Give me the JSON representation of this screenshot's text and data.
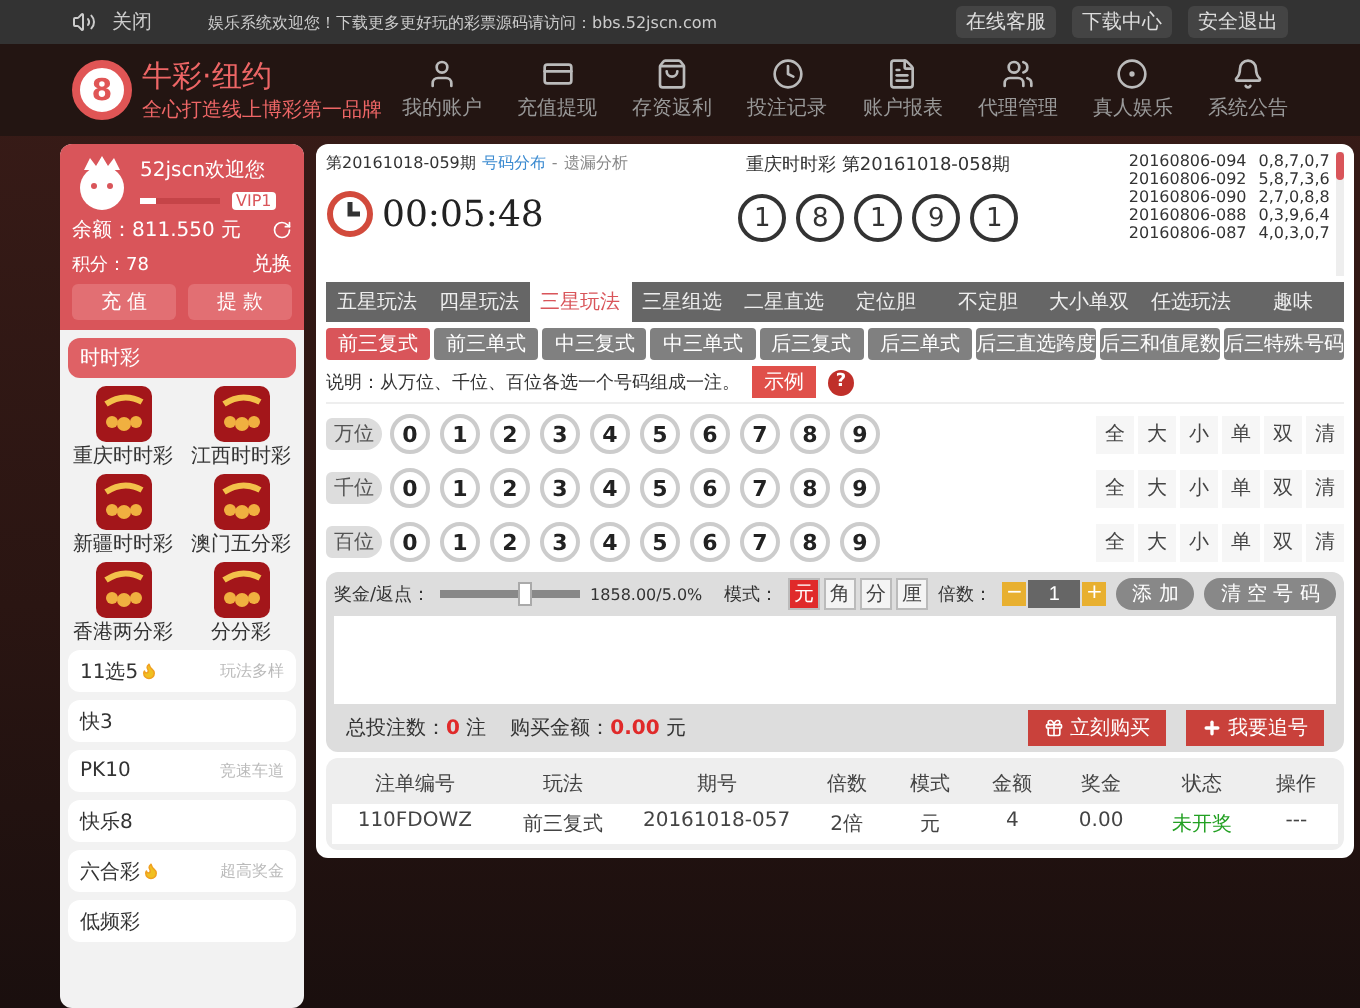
{
  "top_bar": {
    "sound_label": "关闭",
    "notice": "娱乐系统欢迎您！下载更多更好玩的彩票源码请访问：bbs.52jscn.com",
    "links": [
      "在线客服",
      "下载中心",
      "安全退出"
    ]
  },
  "logo": {
    "badge": "8",
    "title": "牛彩·纽约",
    "slogan": "全心打造线上博彩第一品牌"
  },
  "nav": [
    "我的账户",
    "充值提现",
    "存资返利",
    "投注记录",
    "账户报表",
    "代理管理",
    "真人娱乐",
    "系统公告"
  ],
  "sidebar": {
    "user": {
      "name": "52jscn欢迎您",
      "vip": "VIP1",
      "level": 0.2,
      "balance": "余额：811.550 元",
      "points": "积分：78",
      "exchange": "兑换",
      "buttons": [
        "充 值",
        "提 款"
      ]
    },
    "section": "时时彩",
    "games": [
      "重庆时时彩",
      "江西时时彩",
      "新疆时时彩",
      "澳门五分彩",
      "香港两分彩",
      "分分彩"
    ],
    "categories": [
      {
        "label": "11选5",
        "hot": true,
        "note": "玩法多样"
      },
      {
        "label": "快3",
        "hot": false
      },
      {
        "label": "PK10",
        "hot": false,
        "note": "竞速车道"
      },
      {
        "label": "快乐8",
        "hot": false
      },
      {
        "label": "六合彩",
        "hot": true,
        "note": "超高奖金"
      },
      {
        "label": "低频彩",
        "hot": false
      }
    ]
  },
  "draw": {
    "period": "第20161018-059期",
    "links": [
      "号码分布",
      "遗漏分析"
    ],
    "link_separator": "-",
    "countdown": "00:05:48",
    "last_title": "重庆时时彩 第20161018-058期",
    "balls": [
      "1",
      "8",
      "1",
      "9",
      "1"
    ],
    "history": [
      {
        "issue": "20160806-094",
        "numbers": "0,8,7,0,7"
      },
      {
        "issue": "20160806-092",
        "numbers": "5,8,7,3,6"
      },
      {
        "issue": "20160806-090",
        "numbers": "2,7,0,8,8"
      },
      {
        "issue": "20160806-088",
        "numbers": "0,3,9,6,4"
      },
      {
        "issue": "20160806-087",
        "numbers": "4,0,3,0,7"
      }
    ]
  },
  "tabs": [
    {
      "label": "五星玩法",
      "selected": false
    },
    {
      "label": "四星玩法",
      "selected": false
    },
    {
      "label": "三星玩法",
      "selected": true
    },
    {
      "label": "三星组选",
      "selected": false
    },
    {
      "label": "二星直选",
      "selected": false
    },
    {
      "label": "定位胆",
      "selected": false
    },
    {
      "label": "不定胆",
      "selected": false
    },
    {
      "label": "大小单双",
      "selected": false
    },
    {
      "label": "任选玩法",
      "selected": false
    },
    {
      "label": "趣味",
      "selected": false
    }
  ],
  "subtabs": [
    {
      "label": "前三复式",
      "selected": true
    },
    {
      "label": "前三单式",
      "selected": false
    },
    {
      "label": "中三复式",
      "selected": false
    },
    {
      "label": "中三单式",
      "selected": false
    },
    {
      "label": "后三复式",
      "selected": false
    },
    {
      "label": "后三单式",
      "selected": false
    },
    {
      "label": "后三直选跨度",
      "selected": false
    },
    {
      "label": "后三和值尾数",
      "selected": false
    },
    {
      "label": "后三特殊号码",
      "selected": false
    }
  ],
  "description": "说明：从万位、千位、百位各选一个号码组成一注。",
  "example_button": "示例",
  "help": "?",
  "rows": [
    {
      "label": "万位",
      "digits": [
        {
          "n": "0",
          "selected": false
        },
        {
          "n": "1",
          "selected": false
        },
        {
          "n": "2",
          "selected": false
        },
        {
          "n": "3",
          "selected": false
        },
        {
          "n": "4",
          "selected": false
        },
        {
          "n": "5",
          "selected": false
        },
        {
          "n": "6",
          "selected": false
        },
        {
          "n": "7",
          "selected": false
        },
        {
          "n": "8",
          "selected": false
        },
        {
          "n": "9",
          "selected": false
        }
      ],
      "quick": [
        "全",
        "大",
        "小",
        "单",
        "双",
        "清"
      ]
    },
    {
      "label": "千位",
      "digits": [
        {
          "n": "0",
          "selected": false
        },
        {
          "n": "1",
          "selected": false
        },
        {
          "n": "2",
          "selected": false
        },
        {
          "n": "3",
          "selected": false
        },
        {
          "n": "4",
          "selected": false
        },
        {
          "n": "5",
          "selected": false
        },
        {
          "n": "6",
          "selected": false
        },
        {
          "n": "7",
          "selected": false
        },
        {
          "n": "8",
          "selected": false
        },
        {
          "n": "9",
          "selected": false
        }
      ],
      "quick": [
        "全",
        "大",
        "小",
        "单",
        "双",
        "清"
      ]
    },
    {
      "label": "百位",
      "digits": [
        {
          "n": "0",
          "selected": false
        },
        {
          "n": "1",
          "selected": false
        },
        {
          "n": "2",
          "selected": false
        },
        {
          "n": "3",
          "selected": false
        },
        {
          "n": "4",
          "selected": false
        },
        {
          "n": "5",
          "selected": false
        },
        {
          "n": "6",
          "selected": false
        },
        {
          "n": "7",
          "selected": false
        },
        {
          "n": "8",
          "selected": false
        },
        {
          "n": "9",
          "selected": false
        }
      ],
      "quick": [
        "全",
        "大",
        "小",
        "单",
        "双",
        "清"
      ]
    }
  ],
  "bet": {
    "rebate_label": "奖金/返点：",
    "level": 0.6,
    "rebate_value": "1858.00/5.0%",
    "mode_label": "模式：",
    "modes": [
      {
        "label": "元",
        "selected": true
      },
      {
        "label": "角",
        "selected": false
      },
      {
        "label": "分",
        "selected": false
      },
      {
        "label": "厘",
        "selected": false
      }
    ],
    "multiple_label": "倍数：",
    "minus": "−",
    "multiple": "1",
    "plus": "+",
    "add": "添 加",
    "clear": "清 空 号 码",
    "total": "总投注数：**0** 注",
    "amount": "购买金额：**0.00** 元",
    "buy": "立刻购买",
    "chase": "我要追号"
  },
  "table": {
    "columns": [
      "注单编号",
      "玩法",
      "期号",
      "倍数",
      "模式",
      "金额",
      "奖金",
      "状态",
      "操作"
    ],
    "rows": [
      {
        "cells": [
          "110FDOWZ",
          "前三复式",
          "20161018-057",
          "2倍",
          "元",
          "4",
          "0.00",
          "未开奖",
          "---"
        ],
        "color": "#22a022"
      }
    ]
  }
}
